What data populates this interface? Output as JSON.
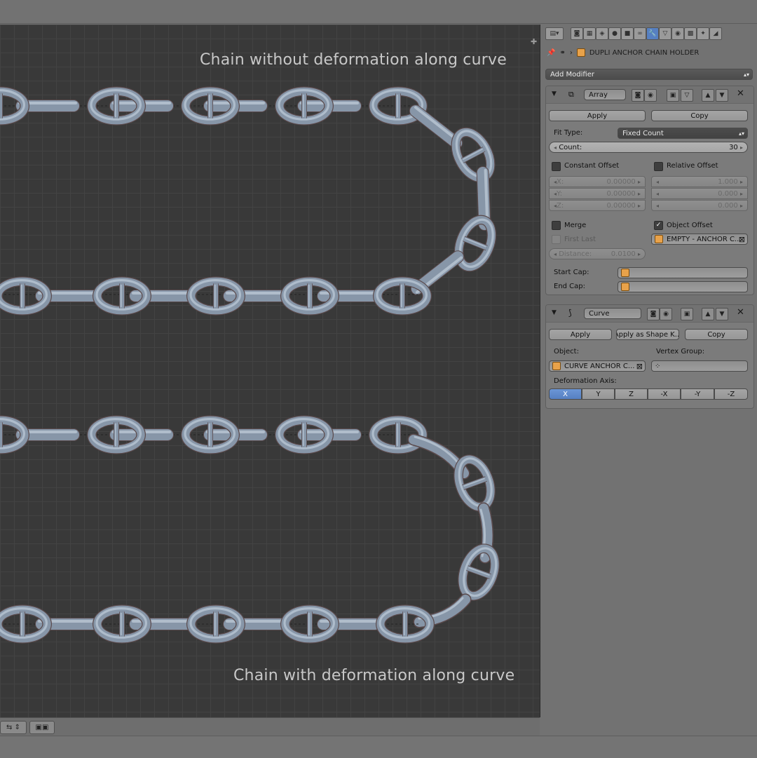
{
  "viewport": {
    "caption_top": "Chain without deformation along curve",
    "caption_bottom": "Chain with deformation along curve"
  },
  "breadcrumb": {
    "object_name": "DUPLI ANCHOR CHAIN HOLDER"
  },
  "add_modifier": "Add Modifier",
  "array": {
    "name": "Array",
    "apply": "Apply",
    "copy": "Copy",
    "fit_type_label": "Fit Type:",
    "fit_type_value": "Fixed Count",
    "count_label": "Count:",
    "count_value": "30",
    "constant_offset": "Constant Offset",
    "relative_offset": "Relative Offset",
    "const_x_label": "X:",
    "const_x": "0.00000",
    "const_y_label": "Y:",
    "const_y": "0.00000",
    "const_z_label": "Z:",
    "const_z": "0.00000",
    "rel_x": "1.000",
    "rel_y": "0.000",
    "rel_z": "0.000",
    "merge": "Merge",
    "first_last": "First Last",
    "distance_label": "Distance:",
    "distance_value": "0.0100",
    "object_offset": "Object Offset",
    "object_offset_target": "EMPTY - ANCHOR C...",
    "start_cap": "Start Cap:",
    "end_cap": "End Cap:"
  },
  "curve": {
    "name": "Curve",
    "apply": "Apply",
    "apply_shape": "Apply as Shape K...",
    "copy": "Copy",
    "object_label": "Object:",
    "vertex_group_label": "Vertex Group:",
    "object_value": "CURVE ANCHOR C...",
    "deform_axis_label": "Deformation Axis:",
    "axes": [
      "X",
      "Y",
      "Z",
      "-X",
      "-Y",
      "-Z"
    ],
    "active_axis": "X"
  },
  "colors": {
    "chain_fill": "#8796a8",
    "chain_highlight": "#aebccb",
    "chain_outline": "#6a5a5a",
    "accent": "#5680c2"
  }
}
